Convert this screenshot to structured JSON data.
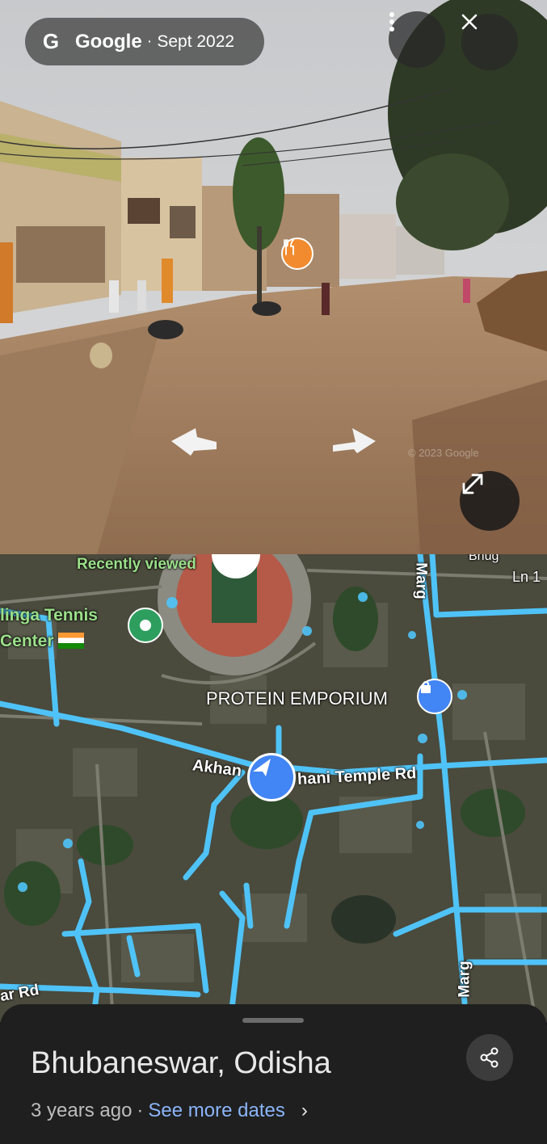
{
  "header": {
    "google_glyph": "G",
    "brand": "Google",
    "separator": "·",
    "capture_date": "Sept 2022"
  },
  "buttons": {
    "menu_icon": "more-vertical-icon",
    "close_icon": "close-icon",
    "expand_icon": "expand-icon"
  },
  "street_view": {
    "watermark": "© 2023 Google",
    "poi_icon": "restaurant-icon"
  },
  "map": {
    "labels": {
      "recently_viewed": "Recently viewed",
      "tennis_line1": "linga Tennis",
      "tennis_line2": "Center",
      "protein": "PROTEIN EMPORIUM",
      "road_left": "Akhan",
      "road_right": "hani Temple Rd",
      "marg_top": "Marg",
      "marg_bottom": "Marg",
      "bhug": "Bhug",
      "ln": "Ln 1",
      "ar_rd": "ar Rd"
    }
  },
  "sheet": {
    "place": "Bhubaneswar, Odisha",
    "age": "3 years ago",
    "separator": "·",
    "see_more": "See more dates",
    "chevron": "›",
    "share_icon": "share-icon"
  },
  "colors": {
    "accent_link": "#8ab4f8",
    "route_blue": "#4fc3f7",
    "poi_orange": "#f28b30",
    "location_blue": "#4285f4"
  }
}
